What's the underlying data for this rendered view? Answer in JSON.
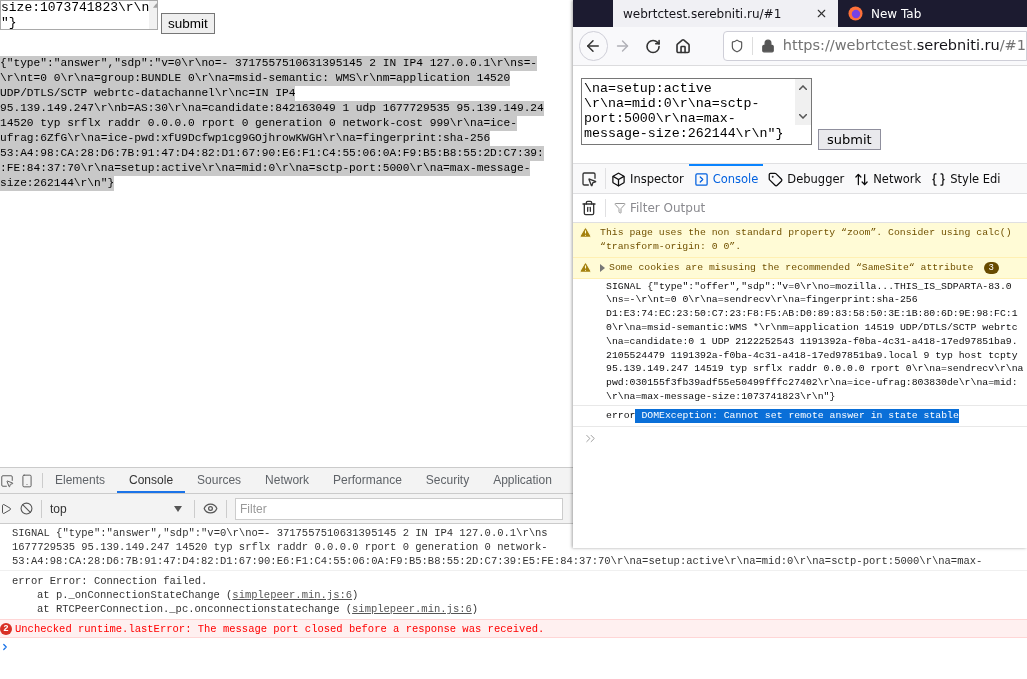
{
  "chrome_page": {
    "textarea_lines": [
      "size:1073741823\\r\\n",
      "\"}"
    ],
    "submit": "submit",
    "answer": {
      "selected": true,
      "lines": [
        "{\"type\":\"answer\",\"sdp\":\"v=0\\r\\no=- 3717557510631395145 2 IN IP4 127.0.0.1\\r\\ns=-",
        "\\r\\nt=0 0\\r\\na=group:BUNDLE 0\\r\\na=msid-semantic: WMS\\r\\nm=application 14520",
        "UDP/DTLS/SCTP webrtc-datachannel\\r\\nc=IN IP4",
        "95.139.149.247\\r\\nb=AS:30\\r\\na=candidate:842163049 1 udp 1677729535 95.139.149.24",
        "14520 typ srflx raddr 0.0.0.0 rport 0 generation 0 network-cost 999\\r\\na=ice-",
        "ufrag:6ZfG\\r\\na=ice-pwd:xfU9Dcfwp1cg9GOjhrowKWGH\\r\\na=fingerprint:sha-256",
        "53:A4:98:CA:28:D6:7B:91:47:D4:82:D1:67:90:E6:F1:C4:55:06:0A:F9:B5:B8:55:2D:C7:39:",
        ":FE:84:37:70\\r\\na=setup:active\\r\\na=mid:0\\r\\na=sctp-port:5000\\r\\na=max-message-",
        "size:262144\\r\\n\"}"
      ]
    }
  },
  "chrome_devtools": {
    "tabs": [
      {
        "label": "Elements",
        "selected": false
      },
      {
        "label": "Console",
        "selected": true
      },
      {
        "label": "Sources",
        "selected": false
      },
      {
        "label": "Network",
        "selected": false
      },
      {
        "label": "Performance",
        "selected": false
      },
      {
        "label": "Security",
        "selected": false
      },
      {
        "label": "Application",
        "selected": false
      }
    ],
    "context": "top",
    "filter_placeholder": "Filter",
    "messages": [
      {
        "kind": "log",
        "lines": [
          "SIGNAL {\"type\":\"answer\",\"sdp\":\"v=0\\r\\no=- 3717557510631395145 2 IN IP4 127.0.0.1\\r\\ns",
          "1677729535 95.139.149.247 14520 typ srflx raddr 0.0.0.0 rport 0 generation 0 network-",
          "53:A4:98:CA:28:D6:7B:91:47:D4:82:D1:67:90:E6:F1:C4:55:06:0A:F9:B5:B8:55:2D:C7:39:E5:FE:84:37:70\\r\\na=setup:active\\r\\na=mid:0\\r\\na=sctp-port:5000\\r\\na=max-"
        ]
      },
      {
        "kind": "trace",
        "head": "error Error: Connection failed.",
        "frames": [
          {
            "text": "at p._onConnectionStateChange (",
            "link": "simplepeer.min.js:6",
            "end": ")"
          },
          {
            "text": "at RTCPeerConnection._pc.onconnectionstatechange (",
            "link": "simplepeer.min.js:6",
            "end": ")"
          }
        ]
      },
      {
        "kind": "error",
        "count": "2",
        "text": "Unchecked runtime.lastError: The message port closed before a response was received."
      }
    ]
  },
  "firefox": {
    "tabs": [
      {
        "title": "webrtctest.serebniti.ru/#1",
        "selected": true
      },
      {
        "title": "New Tab",
        "selected": false
      }
    ],
    "forward_disabled": true,
    "url_parts": [
      {
        "text": "https://webrtctest.",
        "emphasized": false
      },
      {
        "text": "serebniti.ru",
        "emphasized": true
      },
      {
        "text": "/#1",
        "emphasized": false
      }
    ],
    "page": {
      "textarea_lines": [
        "\\na=setup:active",
        "\\r\\na=mid:0\\r\\na=sctp-",
        "port:5000\\r\\na=max-",
        "message-size:262144\\r\\n\"}"
      ],
      "submit": "submit"
    },
    "devtools": {
      "tabs": [
        {
          "label": "Inspector",
          "selected": false
        },
        {
          "label": "Console",
          "selected": true
        },
        {
          "label": "Debugger",
          "selected": false
        },
        {
          "label": "Network",
          "selected": false
        },
        {
          "label": "Style Edi",
          "selected": false
        }
      ],
      "filter_placeholder": "Filter Output",
      "messages": [
        {
          "kind": "warning",
          "lines": [
            "This page uses the non standard property “zoom”. Consider using calc()",
            "“transform-origin: 0 0”."
          ]
        },
        {
          "kind": "group_warning",
          "text": "Some cookies are misusing the recommended “SameSite“ attribute",
          "count": "3"
        },
        {
          "kind": "log",
          "lines": [
            "SIGNAL {\"type\":\"offer\",\"sdp\":\"v=0\\r\\no=mozilla...THIS_IS_SDPARTA-83.0",
            "\\ns=-\\r\\nt=0 0\\r\\na=sendrecv\\r\\na=fingerprint:sha-256",
            "D1:E3:74:EC:23:50:C7:23:F8:F5:AB:D0:89:83:58:50:3E:1B:80:6D:9E:98:FC:1",
            "0\\r\\na=msid-semantic:WMS *\\r\\nm=application 14519 UDP/DTLS/SCTP webrtc",
            "\\na=candidate:0 1 UDP 2122252543 1191392a-f0ba-4c31-a418-17ed97851ba9.",
            "2105524479 1191392a-f0ba-4c31-a418-17ed97851ba9.local 9 typ host tcpty",
            "95.139.149.247 14519 typ srflx raddr 0.0.0.0 rport 0\\r\\na=sendrecv\\r\\na",
            "pwd:030155f3fb39adf55e50499fffc27402\\r\\na=ice-ufrag:803830de\\r\\na=mid:",
            "\\r\\na=max-message-size:1073741823\\r\\n\"}"
          ]
        },
        {
          "kind": "error",
          "label": "error",
          "text": "DOMException: Cannot set remote answer in state stable",
          "highlighted": true
        }
      ]
    }
  }
}
